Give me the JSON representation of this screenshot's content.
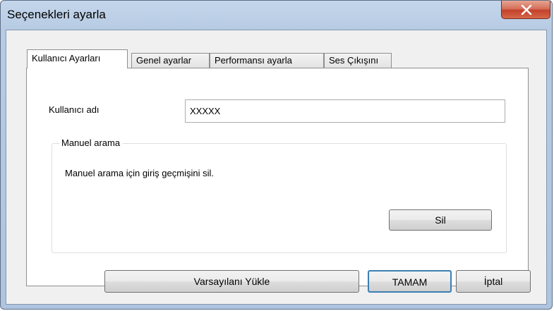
{
  "window": {
    "title": "Seçenekleri ayarla",
    "close_icon": "close-icon"
  },
  "tabs": [
    {
      "label": "Kullanıcı Ayarları",
      "active": true
    },
    {
      "label": "Genel ayarlar",
      "active": false
    },
    {
      "label": "Performansı ayarla",
      "active": false
    },
    {
      "label": "Ses Çıkışını",
      "active": false
    }
  ],
  "user_settings": {
    "username_label": "Kullanıcı adı",
    "username_value": "XXXXX",
    "manual_search": {
      "title": "Manuel arama",
      "description": "Manuel arama için giriş geçmişini sil.",
      "delete_label": "Sil"
    }
  },
  "footer": {
    "load_defaults_label": "Varsayılanı Yükle",
    "ok_label": "TAMAM",
    "cancel_label": "İptal"
  },
  "colors": {
    "titlebar": "#b7cbe4",
    "close_button": "#c4412b",
    "default_button_border": "#3c7fb1"
  }
}
